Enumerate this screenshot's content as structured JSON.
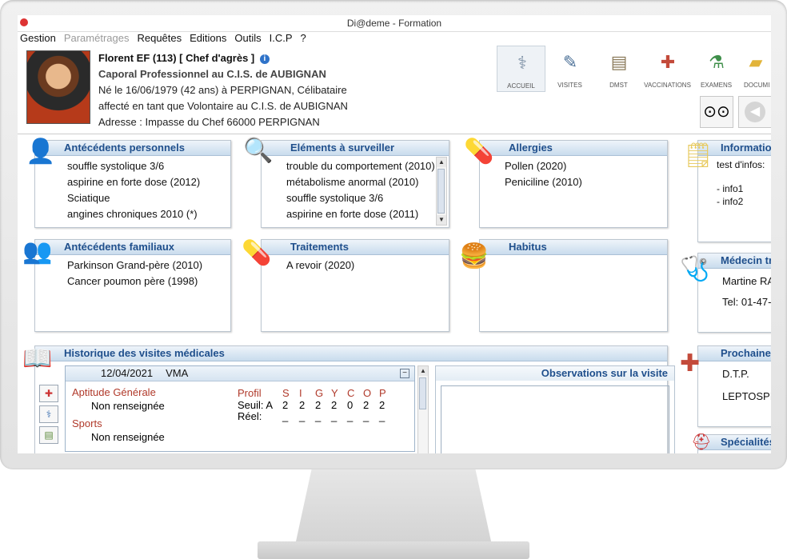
{
  "window": {
    "title": "Di@deme - Formation"
  },
  "menu": [
    "Gestion",
    "Paramétrages",
    "Requêtes",
    "Editions",
    "Outils",
    "I.C.P",
    "?"
  ],
  "patient": {
    "name": "Florent EF (113) [ Chef d'agrès ]",
    "rank": "Caporal Professionnel au C.I.S. de AUBIGNAN",
    "birth": "Né le 16/06/1979 (42 ans) à PERPIGNAN, Célibataire",
    "assignment": "affecté en tant que Volontaire au C.I.S. de AUBIGNAN",
    "address": "Adresse : Impasse du Chef  66000 PERPIGNAN"
  },
  "toolbar": [
    {
      "label": "ACCUEIL",
      "icon": "stethoscope-icon",
      "glyph": "⚕"
    },
    {
      "label": "VISITES",
      "icon": "book-pen-icon",
      "glyph": "✎"
    },
    {
      "label": "DMST",
      "icon": "folder-doctor-icon",
      "glyph": "▤"
    },
    {
      "label": "VACCINATIONS",
      "icon": "syringe-icon",
      "glyph": "✚"
    },
    {
      "label": "EXAMENS",
      "icon": "flask-icon",
      "glyph": "⚗"
    },
    {
      "label": "DOCUMI",
      "icon": "folder-icon",
      "glyph": "▰"
    }
  ],
  "panels": {
    "antecedents_personnels": {
      "title": "Antécédents personnels",
      "items": [
        "souffle systolique 3/6",
        "aspirine en forte dose (2012)",
        "Sciatique",
        "angines chroniques 2010 (*)"
      ]
    },
    "elements_surveiller": {
      "title": "Eléments à surveiller",
      "items": [
        "trouble du comportement (2010)",
        "métabolisme anormal (2010)",
        "souffle systolique 3/6",
        "aspirine en forte dose (2011)"
      ]
    },
    "allergies": {
      "title": "Allergies",
      "items": [
        "Pollen (2020)",
        "Peniciline (2010)"
      ]
    },
    "informations": {
      "title": "Informatio",
      "lines": [
        "test d'infos:",
        "",
        "- info1",
        "- info2"
      ]
    },
    "antecedents_familiaux": {
      "title": "Antécédents familiaux",
      "items": [
        "Parkinson Grand-père (2010)",
        "Cancer poumon père (1998)"
      ]
    },
    "traitements": {
      "title": "Traitements",
      "items": [
        "A revoir (2020)"
      ]
    },
    "habitus": {
      "title": "Habitus",
      "items": []
    },
    "medecin": {
      "title": "Médecin tr",
      "lines": [
        "Martine RA",
        "Tel: 01-47-"
      ]
    },
    "historique": {
      "title": "Historique des visites médicales"
    },
    "prochaine": {
      "title": "Prochaine",
      "lines": [
        "D.T.P.",
        "LEPTOSPI"
      ]
    },
    "specialites": {
      "title": "Spécialités"
    }
  },
  "visit": {
    "date": "12/04/2021",
    "type": "VMA",
    "aptitude_label": "Aptitude Générale",
    "aptitude_value": "Non renseignée",
    "sports_label": "Sports",
    "sports_value": "Non renseignée",
    "profil_label": "Profil",
    "profil_letters": [
      "S",
      "I",
      "G",
      "Y",
      "C",
      "O",
      "P"
    ],
    "seuil_label": "Seuil: A",
    "seuil_values": [
      "2",
      "2",
      "2",
      "2",
      "0",
      "2",
      "2"
    ],
    "reel_label": "Réel:",
    "reel_values": [
      "_",
      "_",
      "_",
      "_",
      "_",
      "_",
      "_"
    ]
  },
  "observations": {
    "title": "Observations sur la visite"
  }
}
